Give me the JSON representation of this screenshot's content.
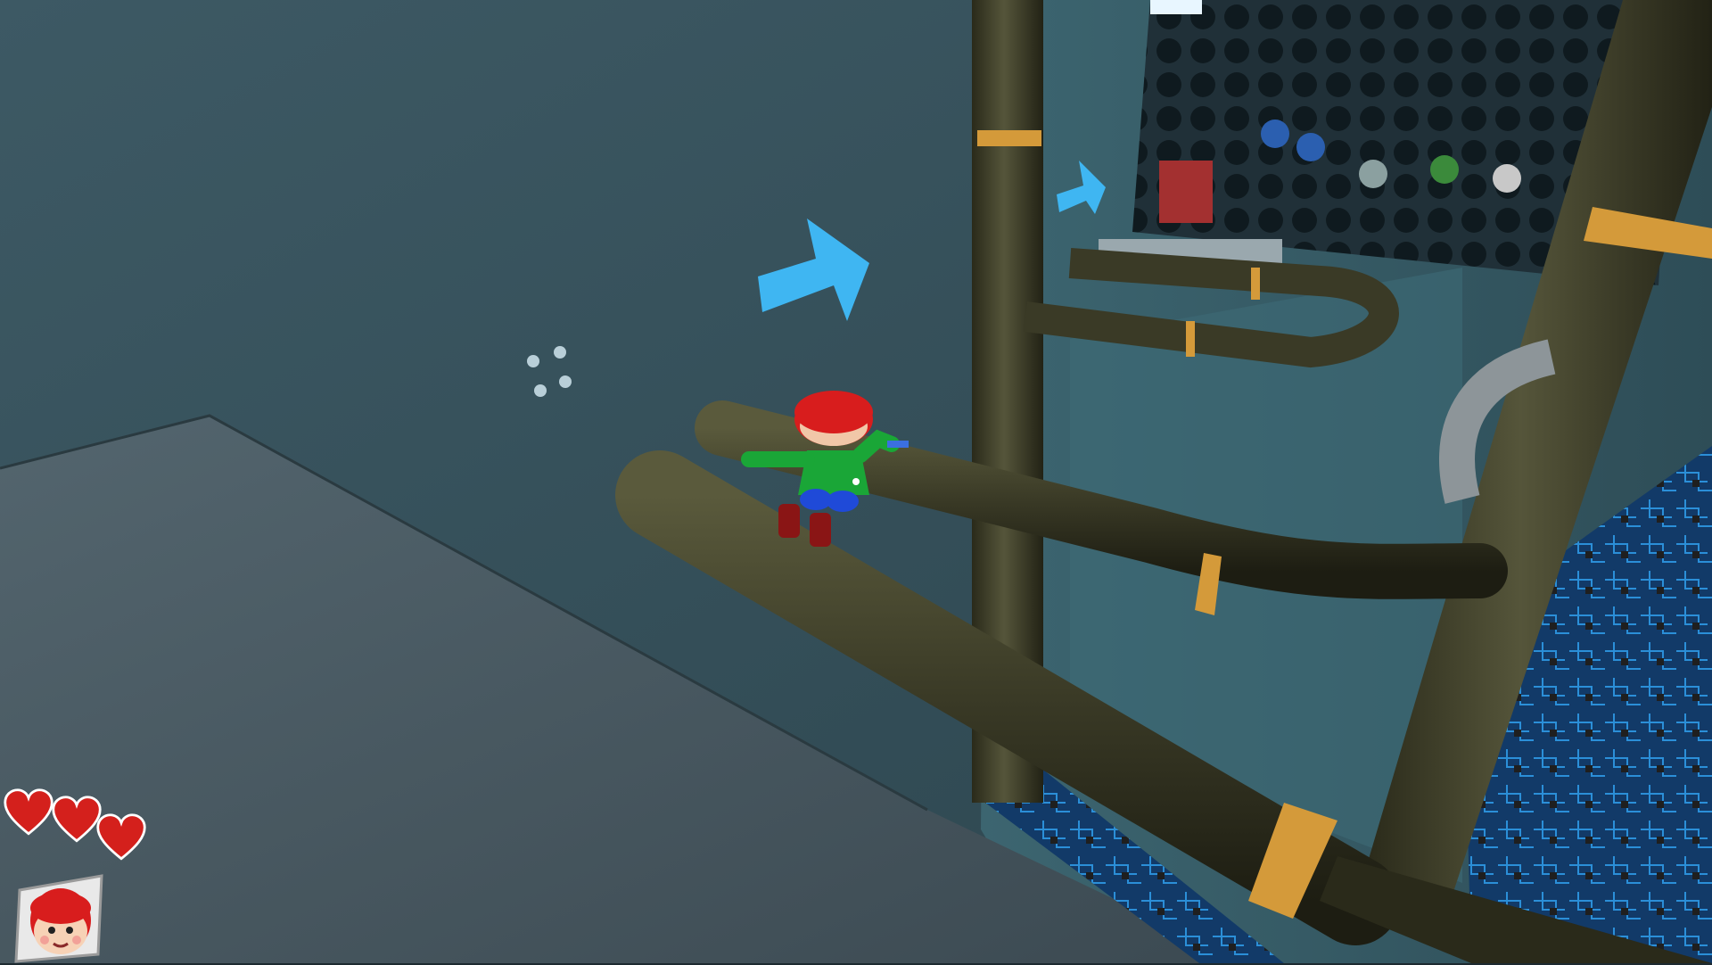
{
  "game": {
    "hud": {
      "hearts_filled": 3,
      "hearts_total": 3,
      "portrait_icon": "player-portrait-icon"
    },
    "colors": {
      "heart": "#d4201c",
      "arrow": "#3fb6f2",
      "pipe": "#3b3a26",
      "pipe_band": "#d49a3a",
      "wall": "#3a5560",
      "floor": "#4a5a63"
    },
    "icons": {
      "heart": "heart-icon",
      "arrow": "direction-arrow-icon"
    }
  }
}
